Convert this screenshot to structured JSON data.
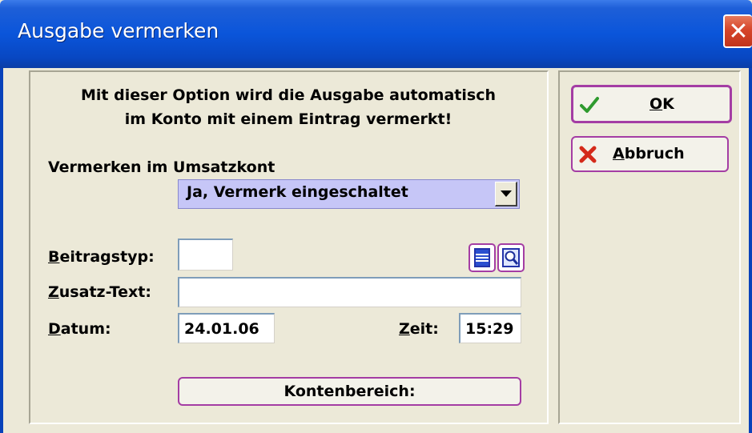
{
  "window": {
    "title": "Ausgabe vermerken",
    "close_glyph": "✕"
  },
  "info": {
    "line1": "Mit dieser Option wird die Ausgabe automatisch",
    "line2": "im Konto mit einem Eintrag vermerkt!"
  },
  "vermerken": {
    "label": "Vermerken im Umsatzkont",
    "selected": "Ja, Vermerk eingeschaltet"
  },
  "beitragstyp": {
    "label_first": "B",
    "label_rest": "eitragstyp:",
    "value": ""
  },
  "zusatz": {
    "label_first": "Z",
    "label_rest": "usatz-Text:",
    "value": ""
  },
  "datum": {
    "label_first": "D",
    "label_rest": "atum:",
    "value": "24.01.06"
  },
  "zeit": {
    "label_first": "Z",
    "label_rest": "eit:",
    "value": "15:29"
  },
  "buttons": {
    "ok_first": "O",
    "ok_rest": "K",
    "cancel_first": "A",
    "cancel_rest": "bbruch",
    "kontenbereich": "Kontenbereich:"
  },
  "icons": {
    "ok": "checkmark-icon",
    "cancel": "x-icon",
    "list": "list-icon",
    "search": "magnifier-icon"
  },
  "colors": {
    "titlebar": "#0A55DA",
    "button_border": "#A43DA4",
    "combo_fill": "#C6C6F7",
    "dialog_bg": "#ECE9D8"
  }
}
